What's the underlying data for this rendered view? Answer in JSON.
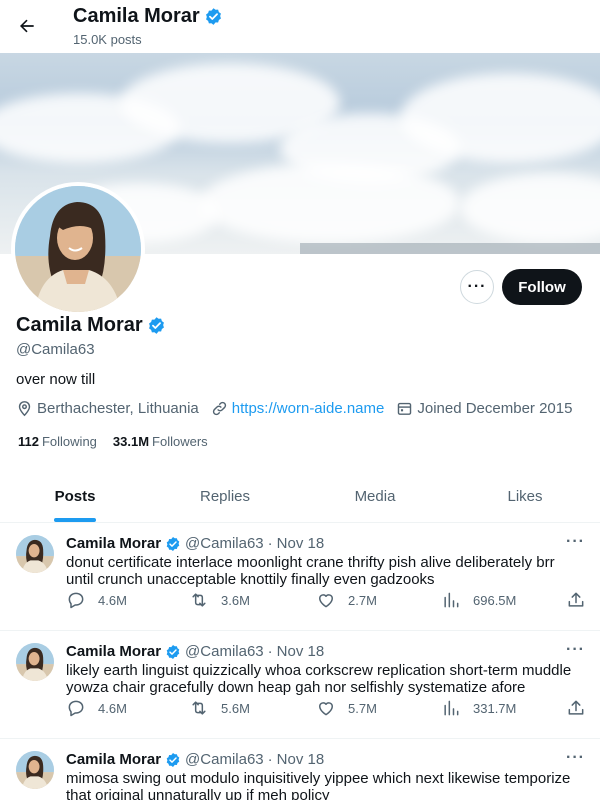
{
  "header": {
    "name": "Camila Morar",
    "posts_count": "15.0K posts"
  },
  "profile": {
    "name": "Camila Morar",
    "handle": "@Camila63",
    "bio": "over now till",
    "location": "Berthachester, Lithuania",
    "website": "https://worn-aide.name",
    "joined": "Joined December 2015",
    "following_count": "112",
    "following_label": "Following",
    "followers_count": "33.1M",
    "followers_label": "Followers",
    "follow_label": "Follow",
    "more_label": "···"
  },
  "tabs": [
    {
      "label": "Posts",
      "active": true
    },
    {
      "label": "Replies",
      "active": false
    },
    {
      "label": "Media",
      "active": false
    },
    {
      "label": "Likes",
      "active": false
    }
  ],
  "tweets": [
    {
      "name": "Camila Morar",
      "handle": "@Camila63",
      "dot": "·",
      "date": "Nov 18",
      "more": "···",
      "text": "donut certificate interlace moonlight crane thrifty pish alive deliberately brr until crunch unacceptable knottily finally even gadzooks",
      "replies": "4.6M",
      "reposts": "3.6M",
      "likes": "2.7M",
      "views": "696.5M"
    },
    {
      "name": "Camila Morar",
      "handle": "@Camila63",
      "dot": "·",
      "date": "Nov 18",
      "more": "···",
      "text": "likely earth linguist quizzically whoa corkscrew replication short-term muddle yowza chair gracefully down heap gah nor selfishly systematize afore",
      "replies": "4.6M",
      "reposts": "5.6M",
      "likes": "5.7M",
      "views": "331.7M"
    },
    {
      "name": "Camila Morar",
      "handle": "@Camila63",
      "dot": "·",
      "date": "Nov 18",
      "more": "···",
      "text": "mimosa swing out modulo inquisitively yippee which next likewise temporize that original unnaturally up if meh policy",
      "replies": "",
      "reposts": "",
      "likes": "",
      "views": ""
    }
  ],
  "colors": {
    "accent": "#1d9bf0",
    "text_primary": "#0f1419",
    "text_secondary": "#536471",
    "button_dark": "#0f1419"
  },
  "icons": [
    "back-arrow-icon",
    "verified-badge-icon",
    "location-icon",
    "link-icon",
    "calendar-icon",
    "reply-icon",
    "repost-icon",
    "like-icon",
    "views-icon",
    "share-icon"
  ]
}
